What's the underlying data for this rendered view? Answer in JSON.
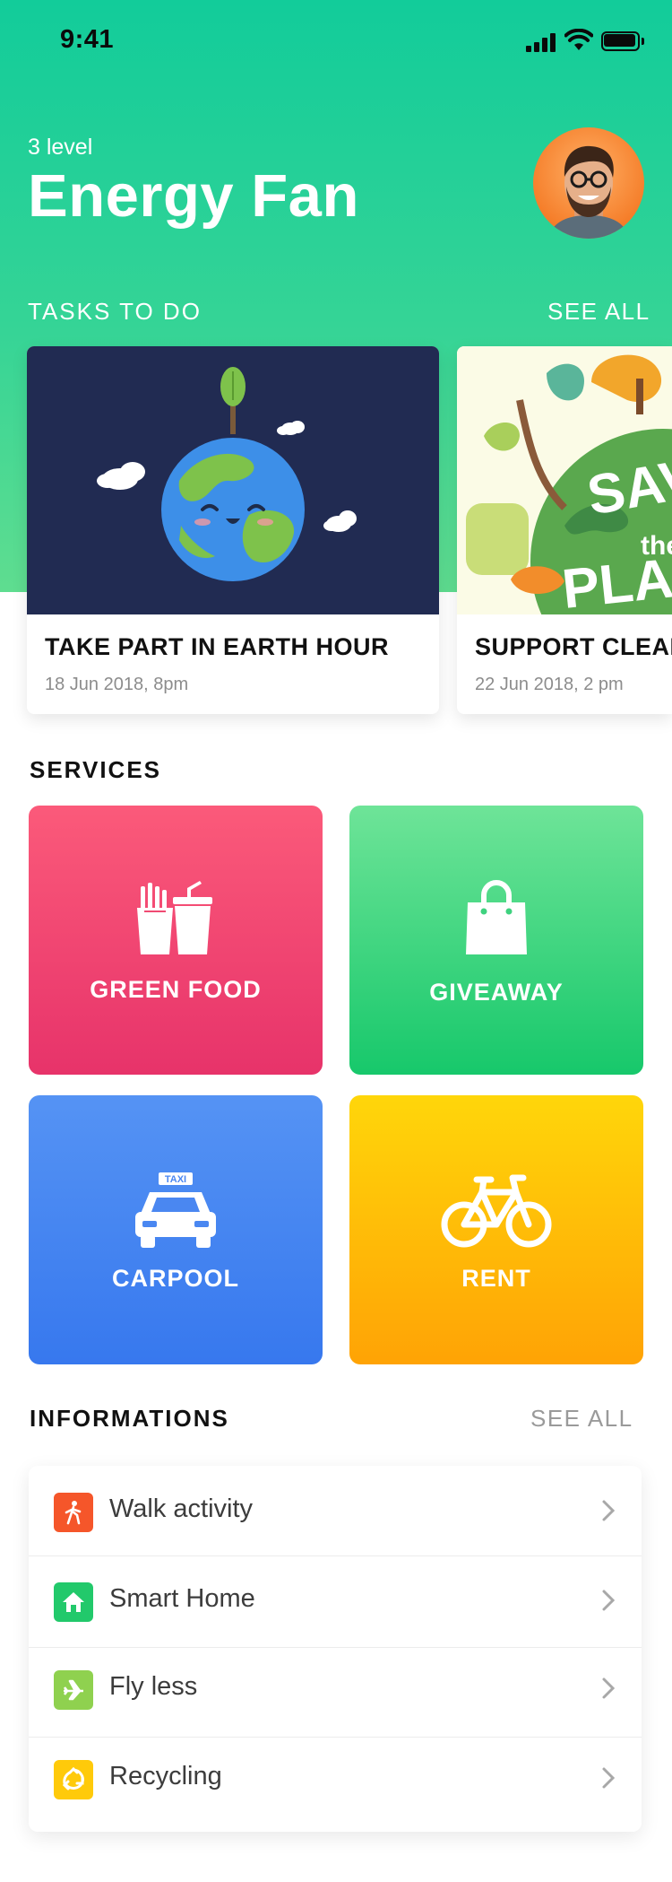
{
  "status_bar": {
    "time": "9:41"
  },
  "profile": {
    "level": "3 level",
    "title": "Energy Fan"
  },
  "tasks": {
    "heading": "TASKS TO DO",
    "see_all": "SEE ALL",
    "items": [
      {
        "title": "TAKE PART IN EARTH HOUR",
        "date": "18 Jun 2018, 8pm"
      },
      {
        "title": "SUPPORT CLEAN",
        "date": "22 Jun 2018, 2 pm",
        "poster_text": [
          "SAVE",
          "the",
          "PLANET"
        ]
      }
    ]
  },
  "services": {
    "heading": "SERVICES",
    "items": [
      {
        "label": "GREEN FOOD",
        "icon": "fast-food-icon",
        "color_top": "#fb5a7a",
        "color_bottom": "#e7336a"
      },
      {
        "label": "GIVEAWAY",
        "icon": "shopping-bag-icon",
        "color_top": "#6ee498",
        "color_bottom": "#17c86b"
      },
      {
        "label": "CARPOOL",
        "icon": "taxi-icon",
        "taxi_sign": "TAXI",
        "color_top": "#5593f4",
        "color_bottom": "#3778ee"
      },
      {
        "label": "RENT",
        "icon": "bicycle-icon",
        "color_top": "#ffd60a",
        "color_bottom": "#ffa305"
      }
    ]
  },
  "informations": {
    "heading": "INFORMATIONS",
    "see_all": "SEE ALL",
    "items": [
      {
        "label": "Walk activity",
        "icon": "walking-person-icon",
        "color": "#f5562a"
      },
      {
        "label": "Smart Home",
        "icon": "home-icon",
        "color": "#22c96b"
      },
      {
        "label": "Fly less",
        "icon": "airplane-icon",
        "color": "#8fd14f"
      },
      {
        "label": "Recycling",
        "icon": "recycle-icon",
        "color": "#ffca0a"
      }
    ]
  },
  "colors": {
    "header_top": "#12cc9a",
    "header_bottom": "#5fdd90",
    "text_dark": "#111111",
    "muted": "#8c8c8c"
  }
}
